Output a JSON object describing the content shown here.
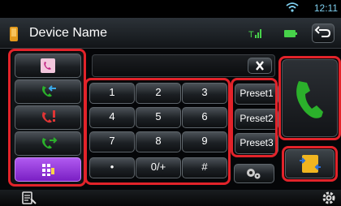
{
  "status": {
    "time": "12:11"
  },
  "header": {
    "title": "Device Name"
  },
  "left_menu": [
    {
      "icon": "call-log-icon",
      "selected": false
    },
    {
      "icon": "incoming-call-icon",
      "selected": false
    },
    {
      "icon": "missed-call-icon",
      "selected": false
    },
    {
      "icon": "outgoing-call-icon",
      "selected": false
    },
    {
      "icon": "dial-pad-icon",
      "selected": true
    }
  ],
  "keypad": {
    "keys": [
      "1",
      "2",
      "3",
      "4",
      "5",
      "6",
      "7",
      "8",
      "9",
      "•",
      "0/+",
      "#"
    ]
  },
  "presets": [
    "Preset1",
    "Preset2",
    "Preset3"
  ],
  "colors": {
    "highlight": "#e2232a",
    "call_green": "#2bb02b",
    "selected_purple": "#8e2fd6",
    "status_blue": "#7fd0f0"
  }
}
